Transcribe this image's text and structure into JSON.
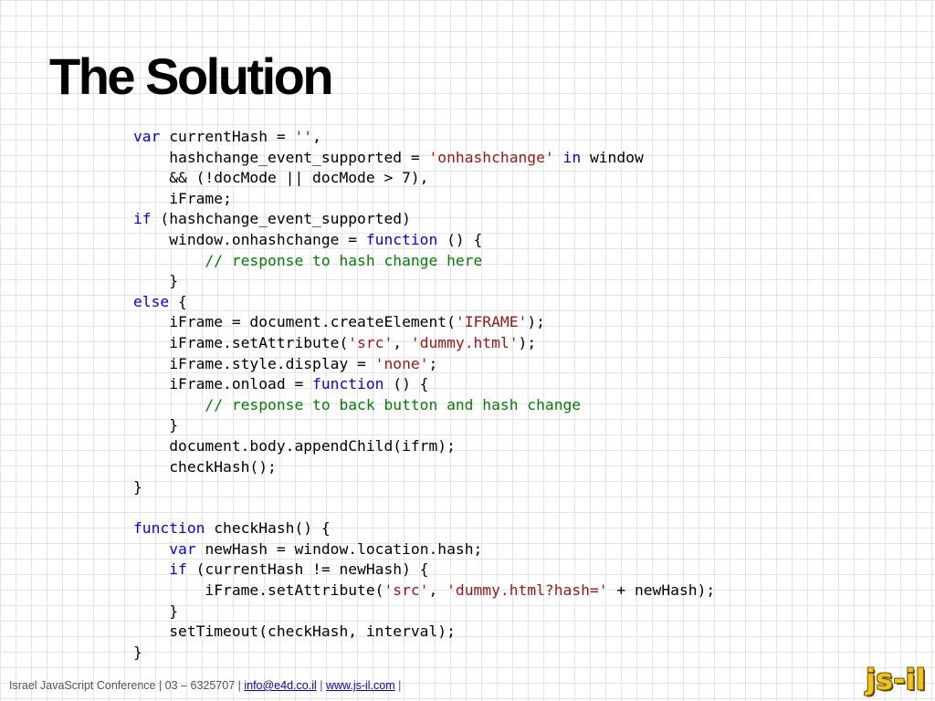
{
  "slide": {
    "title": "The Solution"
  },
  "colors": {
    "keyword": "#0000ff",
    "string": "#a31515",
    "comment": "#008000",
    "plain": "#000000",
    "link": "#0000ee",
    "logo": "#f0c419"
  },
  "code": {
    "lines": [
      [
        {
          "t": "kw",
          "v": "var"
        },
        {
          "t": "plain",
          "v": " currentHash = "
        },
        {
          "t": "str",
          "v": "''"
        },
        {
          "t": "plain",
          "v": ","
        }
      ],
      [
        {
          "t": "plain",
          "v": "    hashchange_event_supported = "
        },
        {
          "t": "str",
          "v": "'onhashchange'"
        },
        {
          "t": "plain",
          "v": " "
        },
        {
          "t": "kw",
          "v": "in"
        },
        {
          "t": "plain",
          "v": " window"
        }
      ],
      [
        {
          "t": "plain",
          "v": "    && (!docMode || docMode > 7),"
        }
      ],
      [
        {
          "t": "plain",
          "v": "    iFrame;"
        }
      ],
      [
        {
          "t": "kw",
          "v": "if"
        },
        {
          "t": "plain",
          "v": " (hashchange_event_supported)"
        }
      ],
      [
        {
          "t": "plain",
          "v": "    window.onhashchange = "
        },
        {
          "t": "kw",
          "v": "function"
        },
        {
          "t": "plain",
          "v": " () {"
        }
      ],
      [
        {
          "t": "com",
          "v": "        // response to hash change here"
        }
      ],
      [
        {
          "t": "plain",
          "v": "    }"
        }
      ],
      [
        {
          "t": "kw",
          "v": "else"
        },
        {
          "t": "plain",
          "v": " {"
        }
      ],
      [
        {
          "t": "plain",
          "v": "    iFrame = document.createElement("
        },
        {
          "t": "str",
          "v": "'IFRAME'"
        },
        {
          "t": "plain",
          "v": ");"
        }
      ],
      [
        {
          "t": "plain",
          "v": "    iFrame.setAttribute("
        },
        {
          "t": "str",
          "v": "'src'"
        },
        {
          "t": "plain",
          "v": ", "
        },
        {
          "t": "str",
          "v": "'dummy.html'"
        },
        {
          "t": "plain",
          "v": ");"
        }
      ],
      [
        {
          "t": "plain",
          "v": "    iFrame.style.display = "
        },
        {
          "t": "str",
          "v": "'none'"
        },
        {
          "t": "plain",
          "v": ";"
        }
      ],
      [
        {
          "t": "plain",
          "v": "    iFrame.onload = "
        },
        {
          "t": "kw",
          "v": "function"
        },
        {
          "t": "plain",
          "v": " () {"
        }
      ],
      [
        {
          "t": "com",
          "v": "        // response to back button and hash change"
        }
      ],
      [
        {
          "t": "plain",
          "v": "    }"
        }
      ],
      [
        {
          "t": "plain",
          "v": "    document.body.appendChild(ifrm);"
        }
      ],
      [
        {
          "t": "plain",
          "v": "    checkHash();"
        }
      ],
      [
        {
          "t": "plain",
          "v": "}"
        }
      ],
      [],
      [
        {
          "t": "kw",
          "v": "function"
        },
        {
          "t": "plain",
          "v": " checkHash() {"
        }
      ],
      [
        {
          "t": "plain",
          "v": "    "
        },
        {
          "t": "kw",
          "v": "var"
        },
        {
          "t": "plain",
          "v": " newHash = window.location.hash;"
        }
      ],
      [
        {
          "t": "plain",
          "v": "    "
        },
        {
          "t": "kw",
          "v": "if"
        },
        {
          "t": "plain",
          "v": " (currentHash != newHash) {"
        }
      ],
      [
        {
          "t": "plain",
          "v": "        iFrame.setAttribute("
        },
        {
          "t": "str",
          "v": "'src'"
        },
        {
          "t": "plain",
          "v": ", "
        },
        {
          "t": "str",
          "v": "'dummy.html?hash='"
        },
        {
          "t": "plain",
          "v": " + newHash);"
        }
      ],
      [
        {
          "t": "plain",
          "v": "    }"
        }
      ],
      [
        {
          "t": "plain",
          "v": "    setTimeout(checkHash, interval);"
        }
      ],
      [
        {
          "t": "plain",
          "v": "}"
        }
      ]
    ]
  },
  "footer": {
    "prefix": "Israel JavaScript Conference | 03 – 6325707 | ",
    "email": "info@e4d.co.il",
    "separator": " | ",
    "website": "www.js-il.com",
    "suffix": " |"
  },
  "logo": {
    "text": "js-il"
  }
}
